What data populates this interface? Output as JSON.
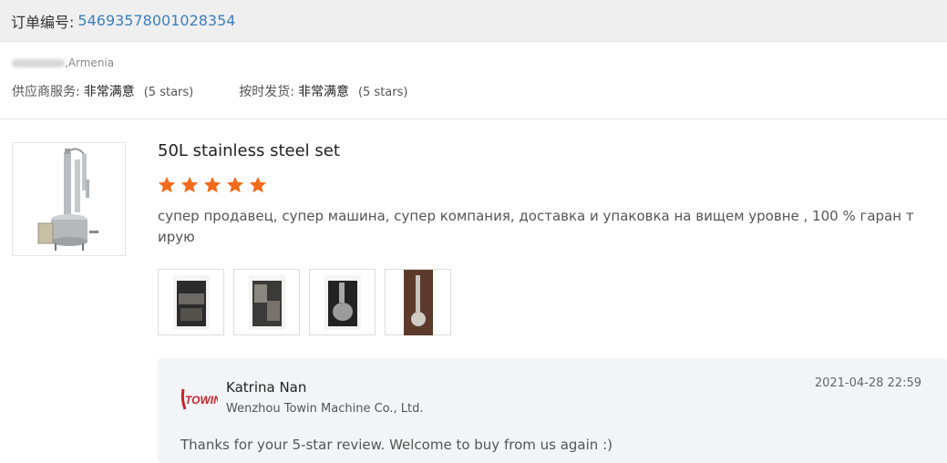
{
  "order": {
    "label": "订单编号:",
    "number": "54693578001028354"
  },
  "buyer": {
    "location": ",Armenia"
  },
  "ratings": [
    {
      "label": "供应商服务:",
      "value": "非常满意",
      "stars_text": "(5 stars)"
    },
    {
      "label": "按时发货:",
      "value": "非常满意",
      "stars_text": "(5 stars)"
    }
  ],
  "product": {
    "title": "50L stainless steel set",
    "rating": 5,
    "star_color": "#f26b1d",
    "review": "супер продавец, супер машина, супер компания, доставка и упаковка на вищем уровне , 100 % гаран тирую"
  },
  "photos": [
    {
      "name": "review-photo-1"
    },
    {
      "name": "review-photo-2"
    },
    {
      "name": "review-photo-3"
    },
    {
      "name": "review-photo-4"
    }
  ],
  "reply": {
    "logo_text": "TOWIN",
    "seller_name": "Katrina Nan",
    "company": "Wenzhou Towin Machine Co., Ltd.",
    "date": "2021-04-28 22:59",
    "text": "Thanks for your 5-star review. Welcome to buy from us again :)"
  },
  "colors": {
    "link_blue": "#3a7fc1",
    "star_orange": "#f26b1d",
    "reply_bg": "#f2f4f7"
  }
}
